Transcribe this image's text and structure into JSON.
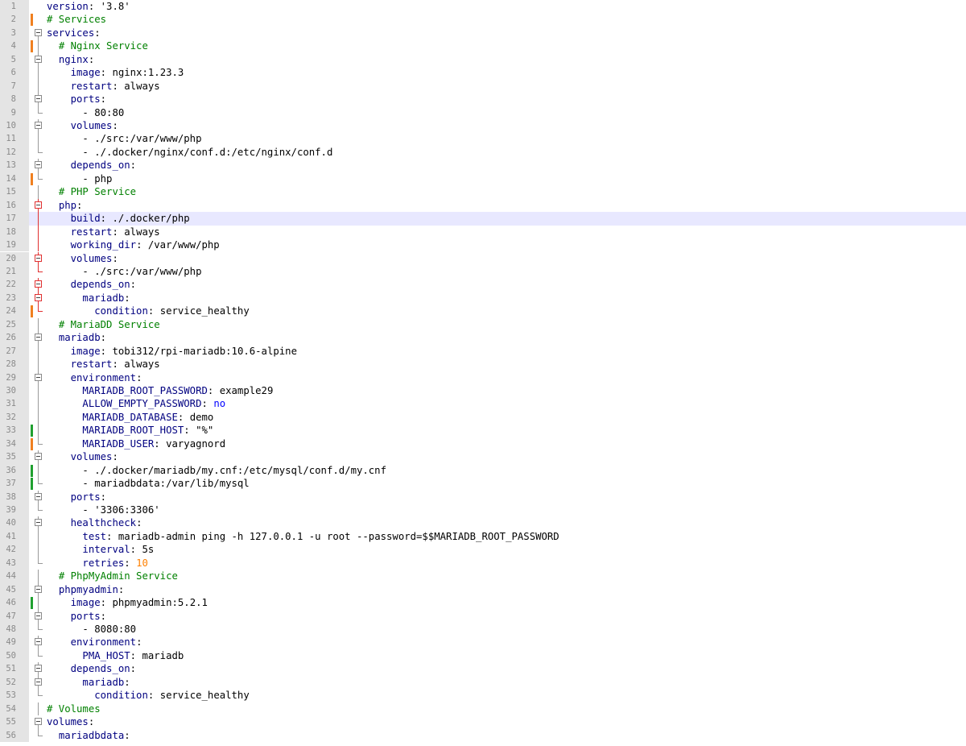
{
  "editor": {
    "current_line": 17,
    "lines": [
      {
        "n": "1",
        "indent": "",
        "key": "version",
        "sep": ": ",
        "value": "'3.8'",
        "vtype": "v",
        "comment": "",
        "change": "",
        "fold": "none"
      },
      {
        "n": "2",
        "indent": "",
        "key": "",
        "sep": "",
        "value": "",
        "vtype": "v",
        "comment": "# Services",
        "change": "orange",
        "fold": "none"
      },
      {
        "n": "3",
        "indent": "",
        "key": "services",
        "sep": ":",
        "value": "",
        "vtype": "v",
        "comment": "",
        "change": "",
        "fold": "open-top"
      },
      {
        "n": "4",
        "indent": "  ",
        "key": "",
        "sep": "",
        "value": "",
        "vtype": "v",
        "comment": "# Nginx Service",
        "change": "orange",
        "fold": "line"
      },
      {
        "n": "5",
        "indent": "  ",
        "key": "nginx",
        "sep": ":",
        "value": "",
        "vtype": "v",
        "comment": "",
        "change": "",
        "fold": "open"
      },
      {
        "n": "6",
        "indent": "    ",
        "key": "image",
        "sep": ": ",
        "value": "nginx:1.23.3",
        "vtype": "v",
        "comment": "",
        "change": "",
        "fold": "line"
      },
      {
        "n": "7",
        "indent": "    ",
        "key": "restart",
        "sep": ": ",
        "value": "always",
        "vtype": "v",
        "comment": "",
        "change": "",
        "fold": "line"
      },
      {
        "n": "8",
        "indent": "    ",
        "key": "ports",
        "sep": ":",
        "value": "",
        "vtype": "v",
        "comment": "",
        "change": "",
        "fold": "open"
      },
      {
        "n": "9",
        "indent": "      ",
        "key": "",
        "sep": "",
        "value": "- 80:80",
        "vtype": "v",
        "comment": "",
        "change": "",
        "fold": "end"
      },
      {
        "n": "10",
        "indent": "    ",
        "key": "volumes",
        "sep": ":",
        "value": "",
        "vtype": "v",
        "comment": "",
        "change": "",
        "fold": "open"
      },
      {
        "n": "11",
        "indent": "      ",
        "key": "",
        "sep": "",
        "value": "- ./src:/var/www/php",
        "vtype": "v",
        "comment": "",
        "change": "",
        "fold": "line"
      },
      {
        "n": "12",
        "indent": "      ",
        "key": "",
        "sep": "",
        "value": "- ./.docker/nginx/conf.d:/etc/nginx/conf.d",
        "vtype": "v",
        "comment": "",
        "change": "",
        "fold": "end"
      },
      {
        "n": "13",
        "indent": "    ",
        "key": "depends_on",
        "sep": ":",
        "value": "",
        "vtype": "v",
        "comment": "",
        "change": "",
        "fold": "open"
      },
      {
        "n": "14",
        "indent": "      ",
        "key": "",
        "sep": "",
        "value": "- php",
        "vtype": "v",
        "comment": "",
        "change": "orange",
        "fold": "end"
      },
      {
        "n": "15",
        "indent": "  ",
        "key": "",
        "sep": "",
        "value": "",
        "vtype": "v",
        "comment": "# PHP Service",
        "change": "",
        "fold": "line"
      },
      {
        "n": "16",
        "indent": "  ",
        "key": "php",
        "sep": ":",
        "value": "",
        "vtype": "v",
        "comment": "",
        "change": "",
        "fold": "open-red"
      },
      {
        "n": "17",
        "indent": "    ",
        "key": "build",
        "sep": ": ",
        "value": "./.docker/php",
        "vtype": "v",
        "comment": "",
        "change": "",
        "fold": "red"
      },
      {
        "n": "18",
        "indent": "    ",
        "key": "restart",
        "sep": ": ",
        "value": "always",
        "vtype": "v",
        "comment": "",
        "change": "",
        "fold": "red"
      },
      {
        "n": "19",
        "indent": "    ",
        "key": "working_dir",
        "sep": ": ",
        "value": "/var/www/php",
        "vtype": "v",
        "comment": "",
        "change": "",
        "fold": "red"
      },
      {
        "n": "20",
        "indent": "    ",
        "key": "volumes",
        "sep": ":",
        "value": "",
        "vtype": "v",
        "comment": "",
        "change": "",
        "fold": "open-red"
      },
      {
        "n": "21",
        "indent": "      ",
        "key": "",
        "sep": "",
        "value": "- ./src:/var/www/php",
        "vtype": "v",
        "comment": "",
        "change": "",
        "fold": "end-red"
      },
      {
        "n": "22",
        "indent": "    ",
        "key": "depends_on",
        "sep": ":",
        "value": "",
        "vtype": "v",
        "comment": "",
        "change": "",
        "fold": "open-red"
      },
      {
        "n": "23",
        "indent": "      ",
        "key": "mariadb",
        "sep": ":",
        "value": "",
        "vtype": "v",
        "comment": "",
        "change": "",
        "fold": "open-red"
      },
      {
        "n": "24",
        "indent": "        ",
        "key": "condition",
        "sep": ": ",
        "value": "service_healthy",
        "vtype": "v",
        "comment": "",
        "change": "orange",
        "fold": "end-red"
      },
      {
        "n": "25",
        "indent": "  ",
        "key": "",
        "sep": "",
        "value": "",
        "vtype": "v",
        "comment": "# MariaDD Service",
        "change": "",
        "fold": "line"
      },
      {
        "n": "26",
        "indent": "  ",
        "key": "mariadb",
        "sep": ":",
        "value": "",
        "vtype": "v",
        "comment": "",
        "change": "",
        "fold": "open"
      },
      {
        "n": "27",
        "indent": "    ",
        "key": "image",
        "sep": ": ",
        "value": "tobi312/rpi-mariadb:10.6-alpine",
        "vtype": "v",
        "comment": "",
        "change": "",
        "fold": "line"
      },
      {
        "n": "28",
        "indent": "    ",
        "key": "restart",
        "sep": ": ",
        "value": "always",
        "vtype": "v",
        "comment": "",
        "change": "",
        "fold": "line"
      },
      {
        "n": "29",
        "indent": "    ",
        "key": "environment",
        "sep": ":",
        "value": "",
        "vtype": "v",
        "comment": "",
        "change": "",
        "fold": "open"
      },
      {
        "n": "30",
        "indent": "      ",
        "key": "MARIADB_ROOT_PASSWORD",
        "sep": ": ",
        "value": "example29",
        "vtype": "v",
        "comment": "",
        "change": "",
        "fold": "line"
      },
      {
        "n": "31",
        "indent": "      ",
        "key": "ALLOW_EMPTY_PASSWORD",
        "sep": ": ",
        "value": "no",
        "vtype": "b",
        "comment": "",
        "change": "",
        "fold": "line"
      },
      {
        "n": "32",
        "indent": "      ",
        "key": "MARIADB_DATABASE",
        "sep": ": ",
        "value": "demo",
        "vtype": "v",
        "comment": "",
        "change": "",
        "fold": "line"
      },
      {
        "n": "33",
        "indent": "      ",
        "key": "MARIADB_ROOT_HOST",
        "sep": ": ",
        "value": "\"%\"",
        "vtype": "v",
        "comment": "",
        "change": "green",
        "fold": "line"
      },
      {
        "n": "34",
        "indent": "      ",
        "key": "MARIADB_USER",
        "sep": ": ",
        "value": "varyagnord",
        "vtype": "v",
        "comment": "",
        "change": "orange",
        "fold": "end"
      },
      {
        "n": "35",
        "indent": "    ",
        "key": "volumes",
        "sep": ":",
        "value": "",
        "vtype": "v",
        "comment": "",
        "change": "",
        "fold": "open"
      },
      {
        "n": "36",
        "indent": "      ",
        "key": "",
        "sep": "",
        "value": "- ./.docker/mariadb/my.cnf:/etc/mysql/conf.d/my.cnf",
        "vtype": "v",
        "comment": "",
        "change": "green",
        "fold": "line"
      },
      {
        "n": "37",
        "indent": "      ",
        "key": "",
        "sep": "",
        "value": "- mariadbdata:/var/lib/mysql",
        "vtype": "v",
        "comment": "",
        "change": "green",
        "fold": "end"
      },
      {
        "n": "38",
        "indent": "    ",
        "key": "ports",
        "sep": ":",
        "value": "",
        "vtype": "v",
        "comment": "",
        "change": "",
        "fold": "open"
      },
      {
        "n": "39",
        "indent": "      ",
        "key": "",
        "sep": "",
        "value": "- '3306:3306'",
        "vtype": "v",
        "comment": "",
        "change": "",
        "fold": "end"
      },
      {
        "n": "40",
        "indent": "    ",
        "key": "healthcheck",
        "sep": ":",
        "value": "",
        "vtype": "v",
        "comment": "",
        "change": "",
        "fold": "open"
      },
      {
        "n": "41",
        "indent": "      ",
        "key": "test",
        "sep": ": ",
        "value": "mariadb-admin ping -h 127.0.0.1 -u root --password=$$MARIADB_ROOT_PASSWORD",
        "vtype": "v",
        "comment": "",
        "change": "",
        "fold": "line"
      },
      {
        "n": "42",
        "indent": "      ",
        "key": "interval",
        "sep": ": ",
        "value": "5s",
        "vtype": "v",
        "comment": "",
        "change": "",
        "fold": "line"
      },
      {
        "n": "43",
        "indent": "      ",
        "key": "retries",
        "sep": ": ",
        "value": "10",
        "vtype": "n",
        "comment": "",
        "change": "",
        "fold": "end"
      },
      {
        "n": "44",
        "indent": "  ",
        "key": "",
        "sep": "",
        "value": "",
        "vtype": "v",
        "comment": "# PhpMyAdmin Service",
        "change": "",
        "fold": "line"
      },
      {
        "n": "45",
        "indent": "  ",
        "key": "phpmyadmin",
        "sep": ":",
        "value": "",
        "vtype": "v",
        "comment": "",
        "change": "",
        "fold": "open"
      },
      {
        "n": "46",
        "indent": "    ",
        "key": "image",
        "sep": ": ",
        "value": "phpmyadmin:5.2.1",
        "vtype": "v",
        "comment": "",
        "change": "green",
        "fold": "line"
      },
      {
        "n": "47",
        "indent": "    ",
        "key": "ports",
        "sep": ":",
        "value": "",
        "vtype": "v",
        "comment": "",
        "change": "",
        "fold": "open"
      },
      {
        "n": "48",
        "indent": "      ",
        "key": "",
        "sep": "",
        "value": "- 8080:80",
        "vtype": "v",
        "comment": "",
        "change": "",
        "fold": "end"
      },
      {
        "n": "49",
        "indent": "    ",
        "key": "environment",
        "sep": ":",
        "value": "",
        "vtype": "v",
        "comment": "",
        "change": "",
        "fold": "open"
      },
      {
        "n": "50",
        "indent": "      ",
        "key": "PMA_HOST",
        "sep": ": ",
        "value": "mariadb",
        "vtype": "v",
        "comment": "",
        "change": "",
        "fold": "end"
      },
      {
        "n": "51",
        "indent": "    ",
        "key": "depends_on",
        "sep": ":",
        "value": "",
        "vtype": "v",
        "comment": "",
        "change": "",
        "fold": "open"
      },
      {
        "n": "52",
        "indent": "      ",
        "key": "mariadb",
        "sep": ":",
        "value": "",
        "vtype": "v",
        "comment": "",
        "change": "",
        "fold": "open"
      },
      {
        "n": "53",
        "indent": "        ",
        "key": "condition",
        "sep": ": ",
        "value": "service_healthy",
        "vtype": "v",
        "comment": "",
        "change": "",
        "fold": "end"
      },
      {
        "n": "54",
        "indent": "",
        "key": "",
        "sep": "",
        "value": "",
        "vtype": "v",
        "comment": "# Volumes",
        "change": "",
        "fold": "line"
      },
      {
        "n": "55",
        "indent": "",
        "key": "volumes",
        "sep": ":",
        "value": "",
        "vtype": "v",
        "comment": "",
        "change": "",
        "fold": "open-top"
      },
      {
        "n": "56",
        "indent": "  ",
        "key": "mariadbdata",
        "sep": ":",
        "value": "",
        "vtype": "v",
        "comment": "",
        "change": "",
        "fold": "end"
      }
    ]
  },
  "colors": {
    "key": "#000080",
    "comment": "#008000",
    "number": "#ff8000",
    "boolean": "#0000ff",
    "change_orange": "#f08020",
    "change_green": "#20a030",
    "fold_active": "#e03030",
    "current_line": "#e8e8ff"
  }
}
